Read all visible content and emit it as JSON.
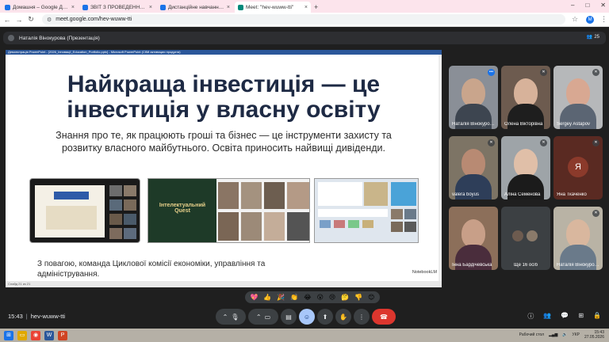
{
  "browser": {
    "tabs": [
      {
        "label": "Домашня – Google Диск",
        "color": "#1a73e8",
        "active": false
      },
      {
        "label": "ЗВІТ З ПРОВЕДЕННЯ ТИЖНЯ",
        "color": "#1a73e8",
        "active": false
      },
      {
        "label": "Дистанційне навчання в ВСП",
        "color": "#1a73e8",
        "active": false
      },
      {
        "label": "Meet: \"hev-wuww-tti\"",
        "color": "#00897b",
        "active": true
      }
    ],
    "new_tab": "+",
    "url": "meet.google.com/hev-wuww-tti",
    "profile_initial": "M"
  },
  "meet": {
    "presenter": "Наталія Вінокурова (Презентація)",
    "participants_count": "25",
    "meeting_code": "hev-wuww-tti",
    "time": "15:43",
    "more_people": "Ще 16 осіб",
    "colors": {
      "accent": "#a8c7fa",
      "end_call": "#dc362e",
      "tile": "#3c4043"
    }
  },
  "slide": {
    "window_title": "Демонстрація PowerPoint - [2026_Інновації_Education_Portfolio.pptx] - Microsoft PowerPoint (Сбій активации продукта)",
    "title": "Найкраща інвестиція — це інвестиція у власну освіту",
    "subtitle": "Знання про те, як працюють гроші та бізнес — це інструменти захисту та розвитку власного майбутнього. Освіта приносить найвищі дивіденди.",
    "shot2_text": "Інтелектуальний Quest",
    "footer": "З повагою, команда Циклової комісії економіки, управління та адміністрування.",
    "logo": "NotebookLM",
    "status": "Слайд 21 из 21"
  },
  "participants": [
    {
      "name": "Наталія Вінокурова",
      "face": "#c9a58c",
      "bg": "#8a8f97",
      "body": "#3d4550"
    },
    {
      "name": "Олена Вікторівна",
      "face": "#d7b29a",
      "bg": "#6d5b4f",
      "body": "#1e1e1e"
    },
    {
      "name": "Sergey Astapov",
      "face": "#d8a892",
      "bg": "#b6b8ba",
      "body": "#5b6573"
    },
    {
      "name": "valera boyus",
      "face": "#b88a73",
      "bg": "#7d7465",
      "body": "#2e3e59"
    },
    {
      "name": "Аліна Семенова",
      "face": "#e0bfa8",
      "bg": "#9ea4a8",
      "body": "#1b1b1b"
    },
    {
      "name": "Яна Ткаченко",
      "initial": "Я"
    },
    {
      "name": "Інна Бардічевська",
      "face": "#c89f88",
      "bg": "#8c6f5a",
      "body": "#4a2d3c"
    },
    {
      "name": "Наталія Вінокурова",
      "face": "#d9b79e",
      "bg": "#b9b3a5",
      "body": "#6a7a8a"
    }
  ],
  "reactions": [
    "💖",
    "👍",
    "🎉",
    "👏",
    "😂",
    "😮",
    "😢",
    "🤔",
    "👎",
    "😊"
  ],
  "taskbar": {
    "desktop_label": "Рабочий стол",
    "lang": "УКР",
    "clock_time": "15:43",
    "clock_date": "27.05.2026"
  }
}
